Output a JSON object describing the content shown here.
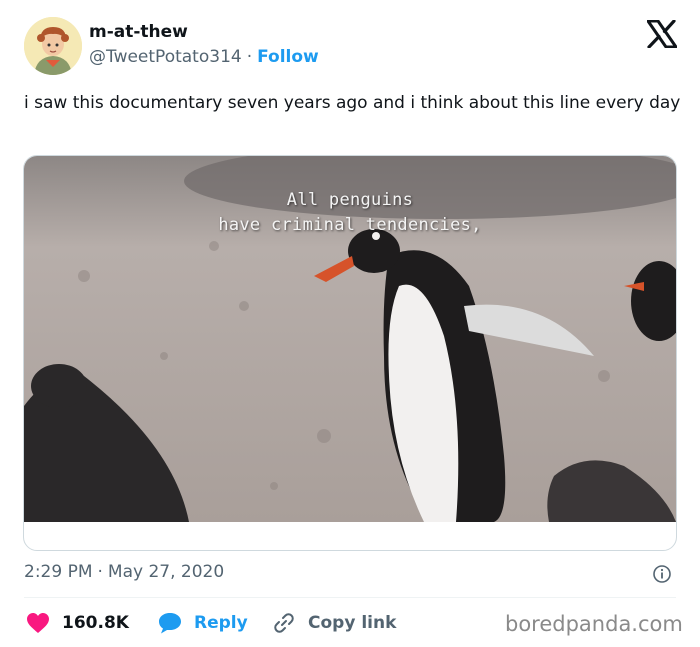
{
  "author": {
    "name": "m-at-thew",
    "handle": "@TweetPotato314",
    "separator": "·",
    "follow_label": "Follow",
    "avatar_icon": "cartoon-avatar-icon"
  },
  "platform_logo": "x-logo-icon",
  "tweet": {
    "text": "i saw this documentary seven years ago and i think about this line every day"
  },
  "media": {
    "caption_line1": "All penguins",
    "caption_line2": "have criminal tendencies,"
  },
  "meta": {
    "time": "2:29 PM",
    "separator": "·",
    "date": "May 27, 2020",
    "info_icon": "info-icon"
  },
  "actions": {
    "likes": "160.8K",
    "reply_label": "Reply",
    "copy_label": "Copy link"
  },
  "watermark": "boredpanda.com",
  "colors": {
    "accent": "#1d9bf0",
    "like": "#f91880",
    "text": "#0f1419",
    "muted": "#536471"
  }
}
